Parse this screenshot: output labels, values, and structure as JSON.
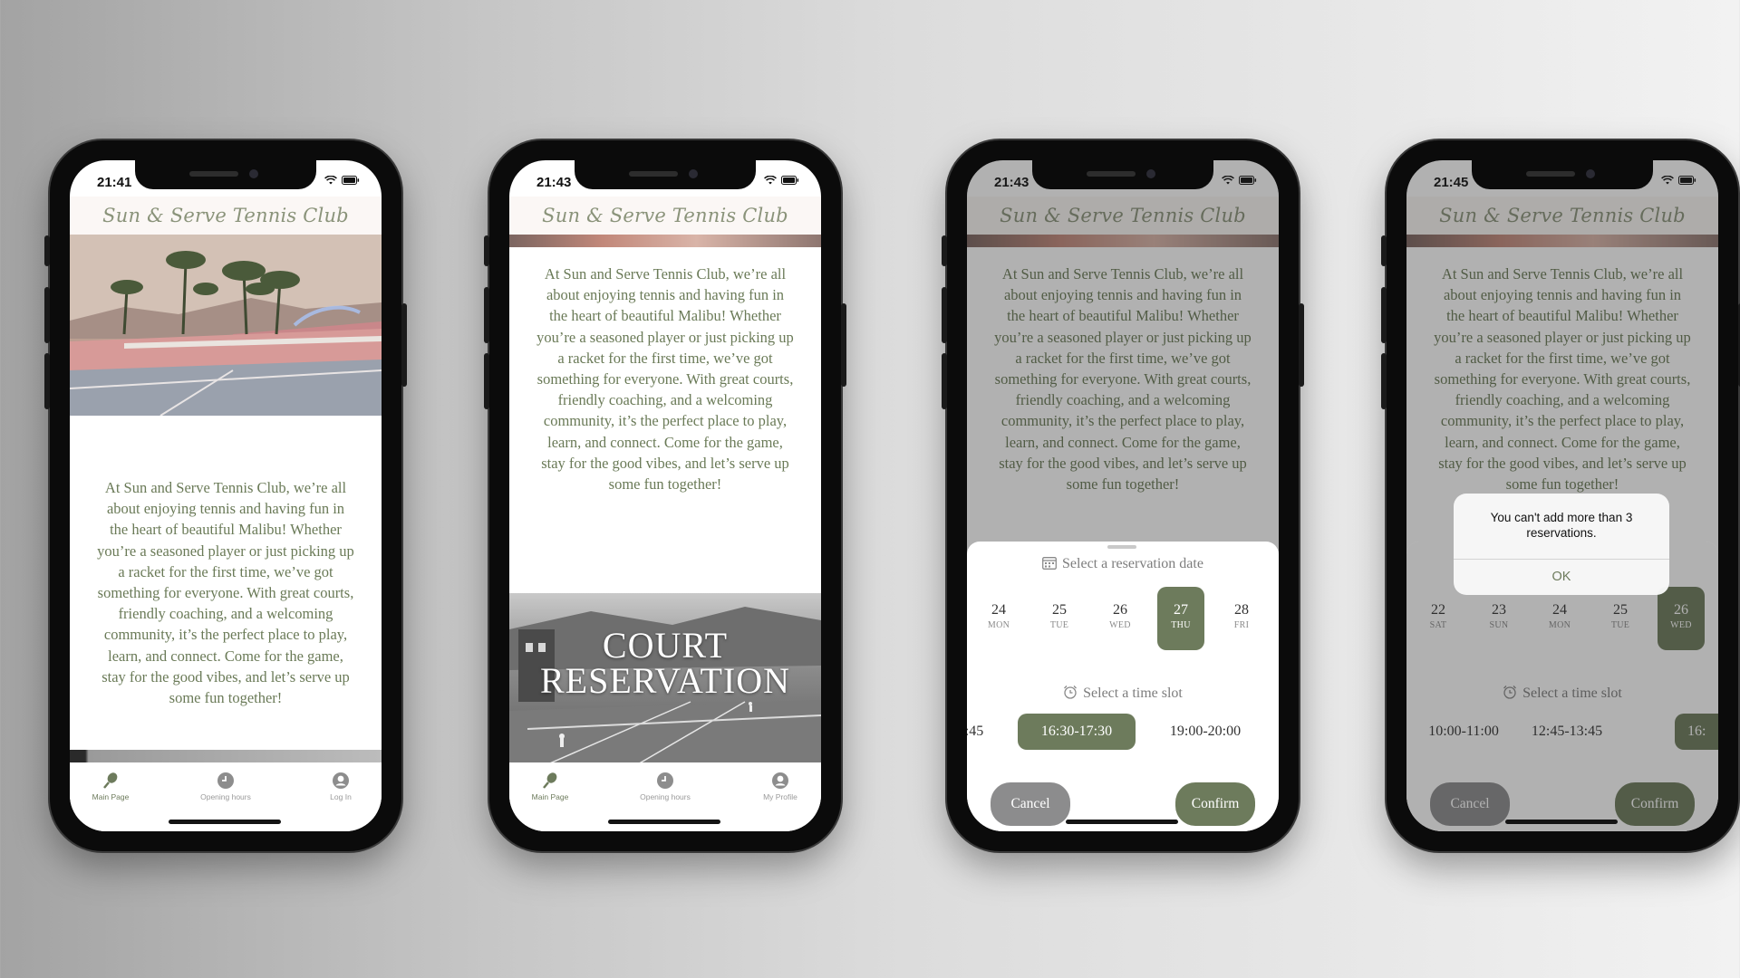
{
  "app": {
    "brand": "Sun & Serve Tennis Club",
    "accent_color": "#6d7b5c",
    "text_color": "#6a7a57"
  },
  "intro_text": "At Sun and Serve Tennis Club, we’re all about enjoying tennis and having fun in the heart of beautiful Malibu! Whether you’re a seasoned player or just picking up a racket for the first time, we’ve got something for everyone. With great courts, friendly coaching, and a welcoming community, it’s the perfect place to play, learn, and connect. Come for the game, stay for the good vibes, and let’s serve up some fun together!",
  "screens": [
    {
      "time": "21:41",
      "tabs": [
        {
          "label": "Main Page",
          "icon": "tennis-racket-icon",
          "active": true
        },
        {
          "label": "Opening hours",
          "icon": "clock-icon",
          "active": false
        },
        {
          "label": "Log In",
          "icon": "profile-icon",
          "active": false
        }
      ]
    },
    {
      "time": "21:43",
      "court_title": "COURT RESERVATION",
      "tabs": [
        {
          "label": "Main Page",
          "icon": "tennis-racket-icon",
          "active": true
        },
        {
          "label": "Opening hours",
          "icon": "clock-icon",
          "active": false
        },
        {
          "label": "My Profile",
          "icon": "profile-icon",
          "active": false
        }
      ]
    },
    {
      "time": "21:43",
      "sheet": {
        "date_label": "Select a reservation date",
        "days": [
          {
            "day": "24",
            "weekday": "MON"
          },
          {
            "day": "25",
            "weekday": "TUE"
          },
          {
            "day": "26",
            "weekday": "WED"
          },
          {
            "day": "27",
            "weekday": "THU",
            "selected": true
          },
          {
            "day": "28",
            "weekday": "FRI"
          }
        ],
        "slot_label": "Select a time slot",
        "slots": [
          ":45",
          "16:30-17:30",
          "19:00-20:00"
        ],
        "selected_slot": "16:30-17:30",
        "cancel": "Cancel",
        "confirm": "Confirm"
      }
    },
    {
      "time": "21:45",
      "sheet": {
        "days": [
          {
            "day": "22",
            "weekday": "SAT"
          },
          {
            "day": "23",
            "weekday": "SUN"
          },
          {
            "day": "24",
            "weekday": "MON"
          },
          {
            "day": "25",
            "weekday": "TUE"
          },
          {
            "day": "26",
            "weekday": "WED",
            "selected": true
          }
        ],
        "slot_label": "Select a time slot",
        "slots": [
          "10:00-11:00",
          "12:45-13:45",
          "16:"
        ],
        "cancel": "Cancel",
        "confirm": "Confirm"
      },
      "alert": {
        "message": "You can't add more than 3 reservations.",
        "ok": "OK"
      }
    }
  ]
}
